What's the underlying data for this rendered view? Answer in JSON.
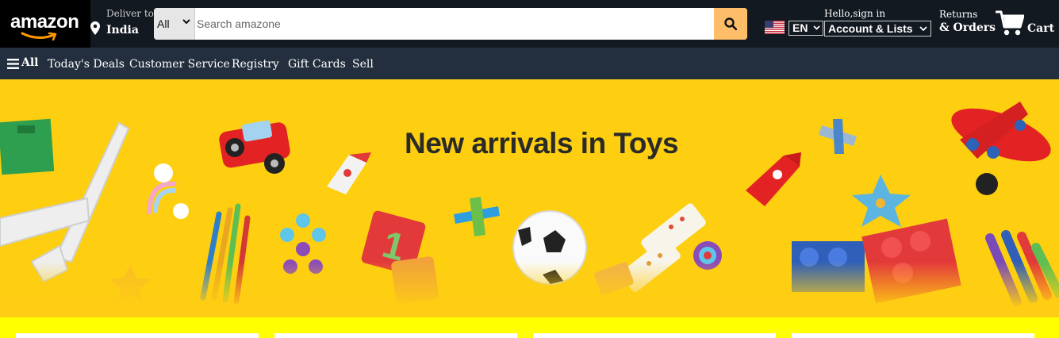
{
  "header": {
    "logo_text": "amazon",
    "deliver_to_label": "Deliver to",
    "deliver_to_location": "India",
    "search": {
      "category": "All",
      "placeholder": "Search amazone",
      "button_icon": "search-icon"
    },
    "language": "EN",
    "account_greeting": "Hello,sign in",
    "account_label": "Account & Lists",
    "returns_line1": "Returns",
    "returns_line2": "& Orders",
    "cart_label": "Cart",
    "colors": {
      "nav_bg": "#131921",
      "logo_bg": "#000000",
      "search_button": "#febd69"
    }
  },
  "subnav": {
    "all_label": "All",
    "items": [
      "Today's Deals",
      "Customer Service",
      "Registry",
      "Gift Cards",
      "Sell"
    ],
    "bg_color": "#232f3e"
  },
  "hero": {
    "title": "New arrivals in Toys",
    "bg_color": "#fdcf10"
  },
  "cards": {
    "count": 4,
    "bg_color": "#ffff00"
  }
}
